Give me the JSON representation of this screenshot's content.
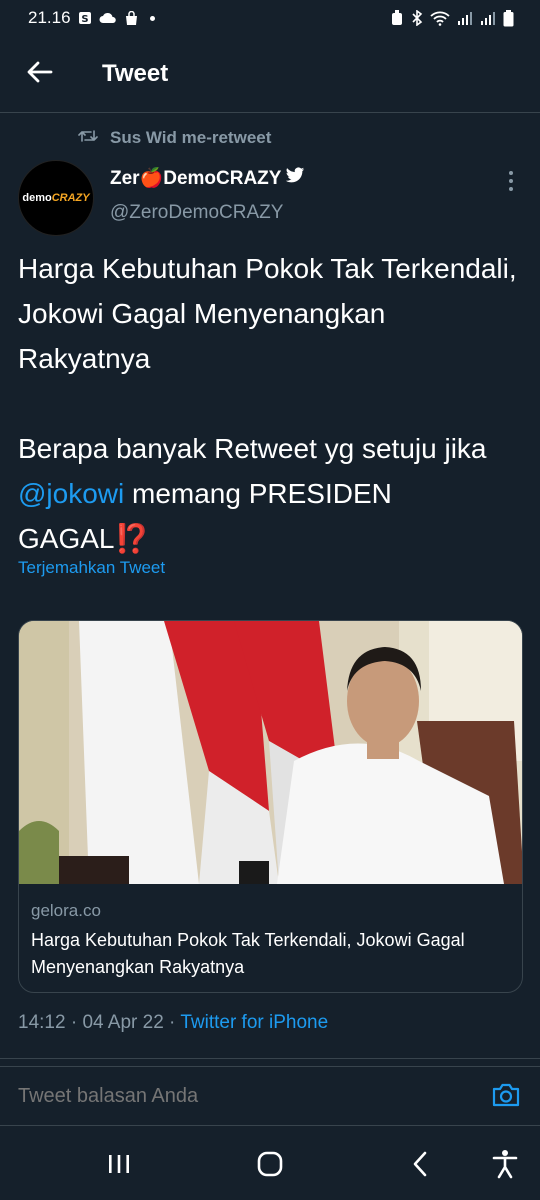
{
  "status_bar": {
    "time": "21.16",
    "icons_left": [
      "s-app-icon",
      "cloud-icon",
      "shopping-bag-icon",
      "dot-icon"
    ],
    "icons_right": [
      "alarm-icon",
      "bluetooth-icon",
      "wifi-icon",
      "signal-icon",
      "signal-icon",
      "battery-icon"
    ]
  },
  "header": {
    "title": "Tweet",
    "back_icon": "arrow-left-icon"
  },
  "retweet": {
    "text": "Sus Wid me-retweet",
    "icon": "retweet-icon"
  },
  "author": {
    "name": "Zer🍎DemoCRAZY",
    "verified_icon": "twitter-bird-icon",
    "handle": "@ZeroDemoCRAZY",
    "avatar_text_1": "demo",
    "avatar_text_2": "CRAZY"
  },
  "tweet": {
    "line1": "Harga Kebutuhan Pokok Tak Terkendali, Jokowi Gagal Menyenangkan Rakyatnya",
    "line2_before": "Berapa banyak Retweet yg setuju jika ",
    "mention": "@jokowi",
    "line2_after": " memang PRESIDEN GAGAL",
    "emoji": "⁉️"
  },
  "translate_label": "Terjemahkan Tweet",
  "card": {
    "domain": "gelora.co",
    "title": "Harga Kebutuhan Pokok Tak Terkendali, Jokowi Gagal Menyenangkan Rakyatnya"
  },
  "meta": {
    "time": "14:12",
    "sep1": " · ",
    "date": "04 Apr 22",
    "sep2": " · ",
    "source": "Twitter for iPhone"
  },
  "reply": {
    "placeholder": "Tweet balasan Anda",
    "camera_icon": "camera-icon"
  },
  "nav": {
    "icons": [
      "recent-apps-icon",
      "home-icon",
      "back-icon",
      "accessibility-icon"
    ]
  },
  "colors": {
    "background": "#15202b",
    "accent": "#1d9bf0",
    "secondary_text": "#8899a6",
    "border": "#38444d"
  }
}
